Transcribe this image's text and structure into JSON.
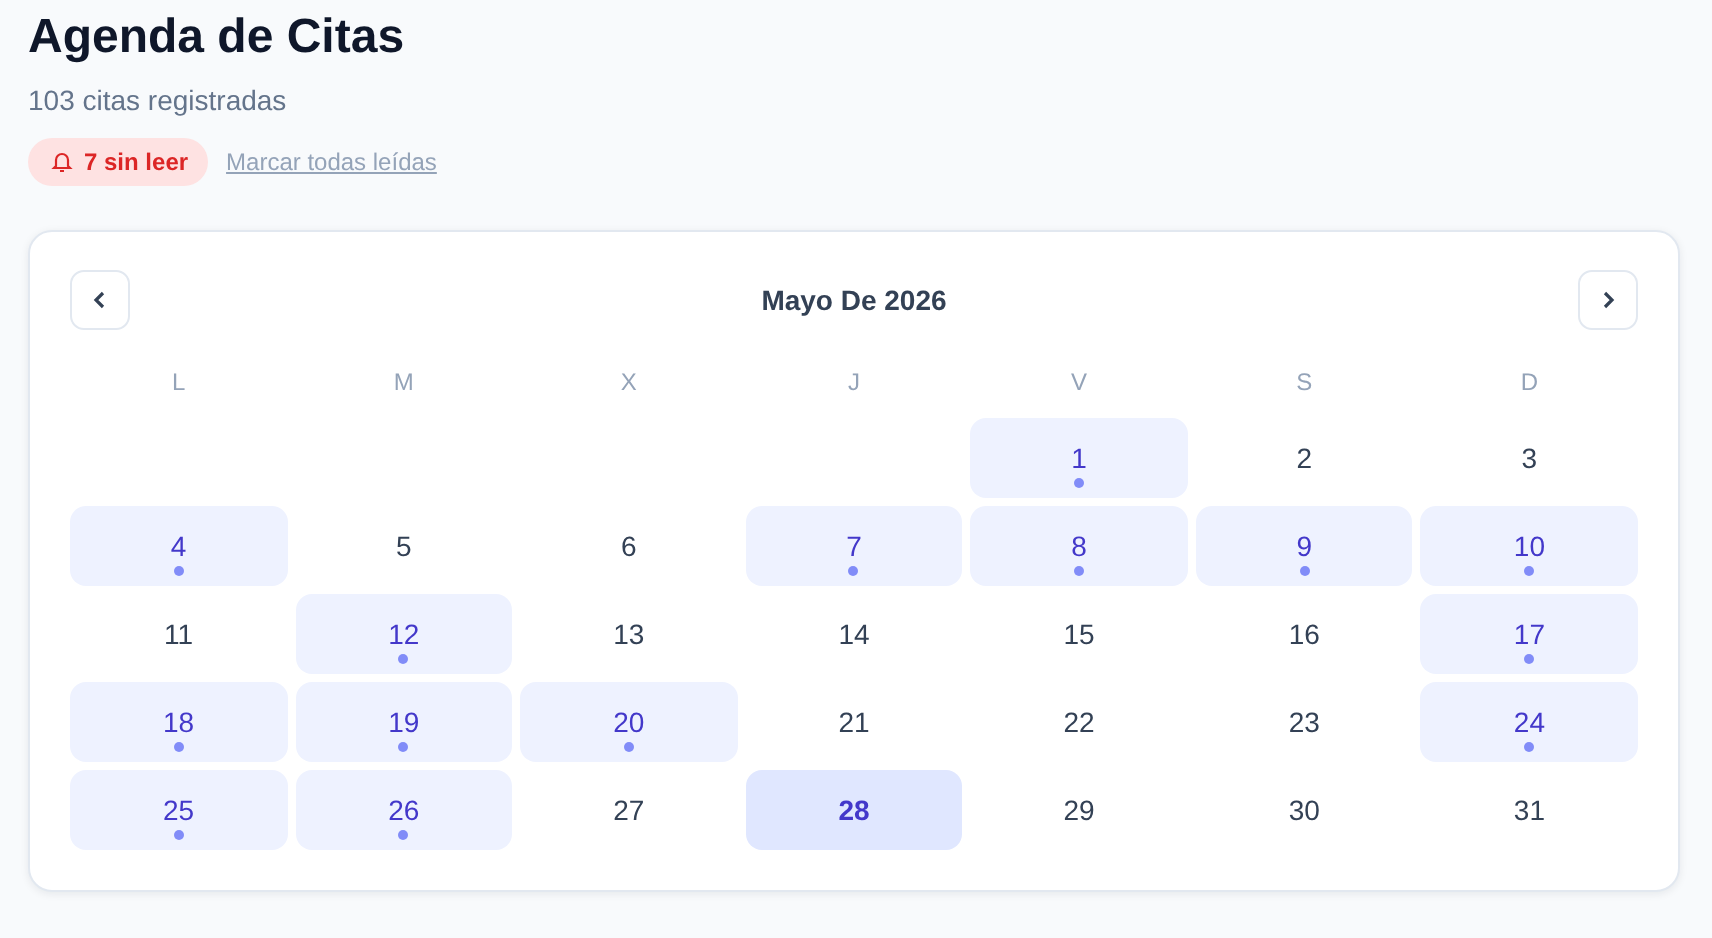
{
  "header": {
    "title": "Agenda de Citas",
    "subtitle": "103 citas registradas",
    "unread_badge": "7 sin leer",
    "mark_all_link": "Marcar todas leídas"
  },
  "calendar": {
    "month_title": "Mayo De 2026",
    "weekdays": [
      "L",
      "M",
      "X",
      "J",
      "V",
      "S",
      "D"
    ],
    "days": [
      {
        "kind": "empty"
      },
      {
        "kind": "empty"
      },
      {
        "kind": "empty"
      },
      {
        "kind": "empty"
      },
      {
        "kind": "day",
        "label": "1",
        "has_events": true,
        "selected": false
      },
      {
        "kind": "day",
        "label": "2",
        "has_events": false,
        "selected": false
      },
      {
        "kind": "day",
        "label": "3",
        "has_events": false,
        "selected": false
      },
      {
        "kind": "day",
        "label": "4",
        "has_events": true,
        "selected": false
      },
      {
        "kind": "day",
        "label": "5",
        "has_events": false,
        "selected": false
      },
      {
        "kind": "day",
        "label": "6",
        "has_events": false,
        "selected": false
      },
      {
        "kind": "day",
        "label": "7",
        "has_events": true,
        "selected": false
      },
      {
        "kind": "day",
        "label": "8",
        "has_events": true,
        "selected": false
      },
      {
        "kind": "day",
        "label": "9",
        "has_events": true,
        "selected": false
      },
      {
        "kind": "day",
        "label": "10",
        "has_events": true,
        "selected": false
      },
      {
        "kind": "day",
        "label": "11",
        "has_events": false,
        "selected": false
      },
      {
        "kind": "day",
        "label": "12",
        "has_events": true,
        "selected": false
      },
      {
        "kind": "day",
        "label": "13",
        "has_events": false,
        "selected": false
      },
      {
        "kind": "day",
        "label": "14",
        "has_events": false,
        "selected": false
      },
      {
        "kind": "day",
        "label": "15",
        "has_events": false,
        "selected": false
      },
      {
        "kind": "day",
        "label": "16",
        "has_events": false,
        "selected": false
      },
      {
        "kind": "day",
        "label": "17",
        "has_events": true,
        "selected": false
      },
      {
        "kind": "day",
        "label": "18",
        "has_events": true,
        "selected": false
      },
      {
        "kind": "day",
        "label": "19",
        "has_events": true,
        "selected": false
      },
      {
        "kind": "day",
        "label": "20",
        "has_events": true,
        "selected": false
      },
      {
        "kind": "day",
        "label": "21",
        "has_events": false,
        "selected": false
      },
      {
        "kind": "day",
        "label": "22",
        "has_events": false,
        "selected": false
      },
      {
        "kind": "day",
        "label": "23",
        "has_events": false,
        "selected": false
      },
      {
        "kind": "day",
        "label": "24",
        "has_events": true,
        "selected": false
      },
      {
        "kind": "day",
        "label": "25",
        "has_events": true,
        "selected": false
      },
      {
        "kind": "day",
        "label": "26",
        "has_events": true,
        "selected": false
      },
      {
        "kind": "day",
        "label": "27",
        "has_events": false,
        "selected": false
      },
      {
        "kind": "day",
        "label": "28",
        "has_events": false,
        "selected": true
      },
      {
        "kind": "day",
        "label": "29",
        "has_events": false,
        "selected": false
      },
      {
        "kind": "day",
        "label": "30",
        "has_events": false,
        "selected": false
      },
      {
        "kind": "day",
        "label": "31",
        "has_events": false,
        "selected": false
      }
    ]
  }
}
